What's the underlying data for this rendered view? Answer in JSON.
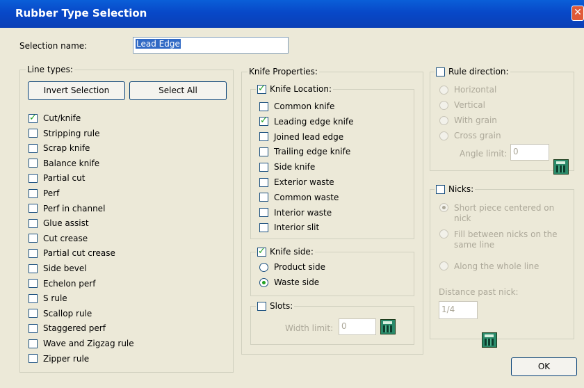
{
  "window": {
    "title": "Rubber Type Selection",
    "close_symbol": "✕"
  },
  "selection": {
    "label": "Selection name:",
    "value": "Lead Edge"
  },
  "line_types": {
    "legend": "Line types:",
    "invert_button": "Invert Selection",
    "select_all_button": "Select All",
    "items": [
      {
        "label": "Cut/knife",
        "checked": true
      },
      {
        "label": "Stripping rule",
        "checked": false
      },
      {
        "label": "Scrap knife",
        "checked": false
      },
      {
        "label": "Balance knife",
        "checked": false
      },
      {
        "label": "Partial cut",
        "checked": false
      },
      {
        "label": "Perf",
        "checked": false
      },
      {
        "label": "Perf in channel",
        "checked": false
      },
      {
        "label": "Glue assist",
        "checked": false
      },
      {
        "label": "Cut crease",
        "checked": false
      },
      {
        "label": "Partial cut crease",
        "checked": false
      },
      {
        "label": "Side bevel",
        "checked": false
      },
      {
        "label": "Echelon perf",
        "checked": false
      },
      {
        "label": "S rule",
        "checked": false
      },
      {
        "label": "Scallop rule",
        "checked": false
      },
      {
        "label": "Staggered perf",
        "checked": false
      },
      {
        "label": "Wave and Zigzag rule",
        "checked": false
      },
      {
        "label": "Zipper rule",
        "checked": false
      }
    ]
  },
  "knife_properties": {
    "legend": "Knife Properties:",
    "location": {
      "legend": "Knife Location:",
      "checked": true,
      "items": [
        {
          "label": "Common knife",
          "checked": false
        },
        {
          "label": "Leading edge knife",
          "checked": true
        },
        {
          "label": "Joined lead edge",
          "checked": false
        },
        {
          "label": "Trailing edge knife",
          "checked": false
        },
        {
          "label": "Side knife",
          "checked": false
        },
        {
          "label": "Exterior waste",
          "checked": false
        },
        {
          "label": "Common waste",
          "checked": false
        },
        {
          "label": "Interior waste",
          "checked": false
        },
        {
          "label": "Interior slit",
          "checked": false
        }
      ]
    },
    "side": {
      "legend": "Knife side:",
      "checked": true,
      "options": [
        {
          "label": "Product side",
          "selected": false
        },
        {
          "label": "Waste side",
          "selected": true
        }
      ]
    },
    "slots": {
      "legend": "Slots:",
      "checked": false,
      "width_label": "Width limit:",
      "width_value": "0"
    }
  },
  "rule_direction": {
    "legend": "Rule direction:",
    "checked": false,
    "options": [
      {
        "label": "Horizontal",
        "selected": false
      },
      {
        "label": "Vertical",
        "selected": false
      },
      {
        "label": "With grain",
        "selected": false
      },
      {
        "label": "Cross grain",
        "selected": false
      }
    ],
    "angle_label": "Angle limit:",
    "angle_value": "0"
  },
  "nicks": {
    "legend": "Nicks:",
    "checked": false,
    "options": [
      {
        "label": "Short piece centered on nick",
        "selected": true
      },
      {
        "label": "Fill between nicks on the same line",
        "selected": false
      },
      {
        "label": "Along the whole line",
        "selected": false
      }
    ],
    "distance_label": "Distance past nick:",
    "distance_value": "1/4"
  },
  "ok_button": "OK",
  "icons": {
    "calculator": "calculator-icon"
  }
}
